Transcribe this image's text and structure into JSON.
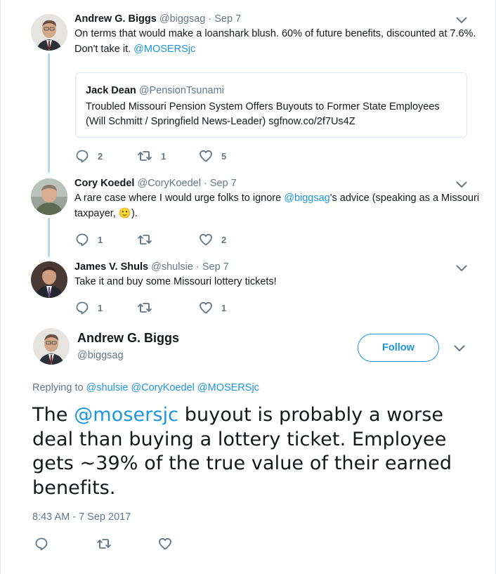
{
  "colors": {
    "link": "#1b95e0",
    "muted": "#657786",
    "thread_line": "#b5d9f3",
    "text": "#14171a"
  },
  "replies": [
    {
      "name": "Andrew G. Biggs",
      "handle": "@biggsag",
      "date": "· Sep 7",
      "text_before": "On terms that would make a loanshark blush. 60% of future benefits, discounted at 7.6%. Don't take it. ",
      "mention": "@MOSERSjc",
      "quote": {
        "name": "Jack Dean",
        "handle": "@PensionTsunami",
        "text": "Troubled Missouri Pension System Offers Buyouts to Former State Employees (Will Schmitt / Springfield News-Leader) sgfnow.co/2f7Us4Z"
      },
      "counts": {
        "replies": "2",
        "retweets": "1",
        "likes": "5"
      }
    },
    {
      "name": "Cory Koedel",
      "handle": "@CoryKoedel",
      "date": "· Sep 7",
      "text_before": "A rare case where I would urge folks to ignore ",
      "mention": "@biggsag",
      "text_after": "'s advice (speaking as a Missouri taxpayer, ",
      "emoji": "🙂",
      "text_end": ").",
      "counts": {
        "replies": "1",
        "retweets": "",
        "likes": "2"
      }
    },
    {
      "name": "James V. Shuls",
      "handle": "@shulsie",
      "date": "· Sep 7",
      "text": "Take it and buy some Missouri lottery tickets!",
      "counts": {
        "replies": "1",
        "retweets": "",
        "likes": "1"
      }
    }
  ],
  "main": {
    "name": "Andrew G. Biggs",
    "handle": "@biggsag",
    "follow_label": "Follow",
    "replying_label": "Replying to",
    "replying_to": [
      "@shulsie",
      "@CoryKoedel",
      "@MOSERSjc"
    ],
    "text_before": "The ",
    "mention": "@mosersjc",
    "text_after": " buyout is probably a worse deal than buying a lottery ticket. Employee gets ~39% of the true value of their earned benefits.",
    "timestamp": "8:43 AM - 7 Sep 2017"
  },
  "icons": [
    "reply-icon",
    "retweet-icon",
    "like-icon",
    "chevron-down-icon"
  ]
}
